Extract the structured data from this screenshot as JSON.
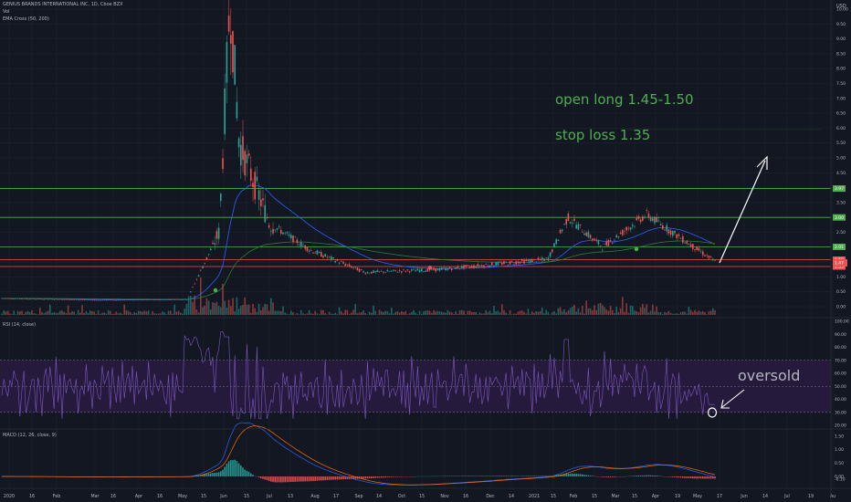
{
  "header": {
    "title": "GENIUS BRANDS INTERNATIONAL INC, 1D, Cboe BZX",
    "line2": "Vol",
    "line3": "EMA Cross (50, 200)"
  },
  "currency": "USD",
  "rsi_label": "RSI (14, close)",
  "macd_label": "MACD (12, 26, close, 9)",
  "annotations": {
    "open_long": "open long 1.45-1.50",
    "stop_loss": "stop loss 1.35",
    "oversold": "oversold"
  },
  "colors": {
    "background": "#131722",
    "grid": "#1e222d",
    "up": "#26a69a",
    "down": "#ef5350",
    "annotation": "#4caf50",
    "rsi_band": "#2a1c44",
    "rsi_line": "#7e57c2",
    "ema_fast": "#2962ff",
    "ema_slow": "#2e7d32",
    "macd_line": "#2962ff",
    "signal_line": "#ff6d00"
  },
  "chart_data": {
    "type": "candlestick",
    "price_axis": {
      "ticks": [
        0.0,
        0.5,
        1.0,
        1.5,
        2.0,
        2.5,
        3.0,
        3.5,
        4.0,
        4.5,
        5.0,
        5.5,
        6.0,
        6.5,
        7.0,
        7.5,
        8.0,
        8.5,
        9.0,
        9.5,
        10.0
      ],
      "tick_labels": [
        "0.00",
        "0.50",
        "1.00",
        "1.50",
        "2.00",
        "2.50",
        "3.00",
        "3.50",
        "4.00",
        "4.50",
        "5.00",
        "5.50",
        "6.00",
        "6.50",
        "7.00",
        "7.50",
        "8.00",
        "8.50",
        "9.00",
        "9.50",
        "10.00"
      ],
      "ylim": [
        0,
        10.5
      ]
    },
    "horizontal_lines": [
      {
        "value": 3.97,
        "label": "3.97",
        "color": "#4caf50"
      },
      {
        "value": 3.0,
        "label": "3.00",
        "color": "#4caf50"
      },
      {
        "value": 2.01,
        "label": "2.01",
        "color": "#4caf50"
      },
      {
        "value": 1.58,
        "label": "1.58",
        "color": "#ef5350"
      },
      {
        "value": 1.35,
        "label": "1.35",
        "color": "#ef5350"
      }
    ],
    "last_price": {
      "value": 1.47,
      "label": "1.47",
      "color": "#ef5350"
    },
    "x_axis_labels": [
      "2020",
      "16",
      "Feb",
      "Mar",
      "16",
      "Apr",
      "16",
      "May",
      "15",
      "Jun",
      "15",
      "Jul",
      "13",
      "Aug",
      "17",
      "Sep",
      "14",
      "Oct",
      "15",
      "Nov",
      "16",
      "Dec",
      "14",
      "2021",
      "15",
      "Feb",
      "15",
      "Mar",
      "15",
      "Apr",
      "19",
      "May",
      "17",
      "Jun",
      "14",
      "Jul",
      "19",
      "Au"
    ],
    "x_axis_positions": [
      10,
      35,
      62,
      104,
      124,
      152,
      175,
      200,
      223,
      245,
      270,
      295,
      318,
      345,
      368,
      393,
      415,
      440,
      462,
      487,
      510,
      537,
      560,
      585,
      606,
      628,
      651,
      674,
      695,
      718,
      742,
      764,
      788,
      815,
      838,
      862,
      888,
      912
    ],
    "price_series": {
      "name": "GENIUS BRANDS INTERNATIONAL INC",
      "x_labels": [
        "2020-01",
        "2020-03",
        "2020-05-20",
        "2020-06-03",
        "2020-06-08",
        "2020-06-15",
        "2020-07-01",
        "2020-08-01",
        "2020-09-15",
        "2020-11-15",
        "2021-01-15",
        "2021-02-01",
        "2021-03-15",
        "2021-04-06",
        "2021-05-07"
      ],
      "close": [
        0.28,
        0.22,
        0.25,
        2.5,
        10.4,
        5.5,
        2.8,
        1.9,
        1.15,
        1.25,
        1.6,
        3.0,
        2.0,
        3.1,
        1.47
      ]
    },
    "rsi": {
      "axis_ticks": [
        20,
        30,
        40,
        50,
        60,
        70,
        80,
        90,
        100
      ],
      "tick_labels": [
        "20.00",
        "30.00",
        "40.00",
        "50.00",
        "60.00",
        "70.00",
        "80.00",
        "90.00",
        "100.00"
      ],
      "upper_band": 70,
      "lower_band": 30
    },
    "macd": {
      "axis_ticks": [
        -0.1,
        0.0,
        0.5,
        1.0,
        1.5
      ],
      "tick_labels": [
        "-0.10",
        "0.00",
        "0.50",
        "1.00",
        "1.50"
      ]
    }
  }
}
